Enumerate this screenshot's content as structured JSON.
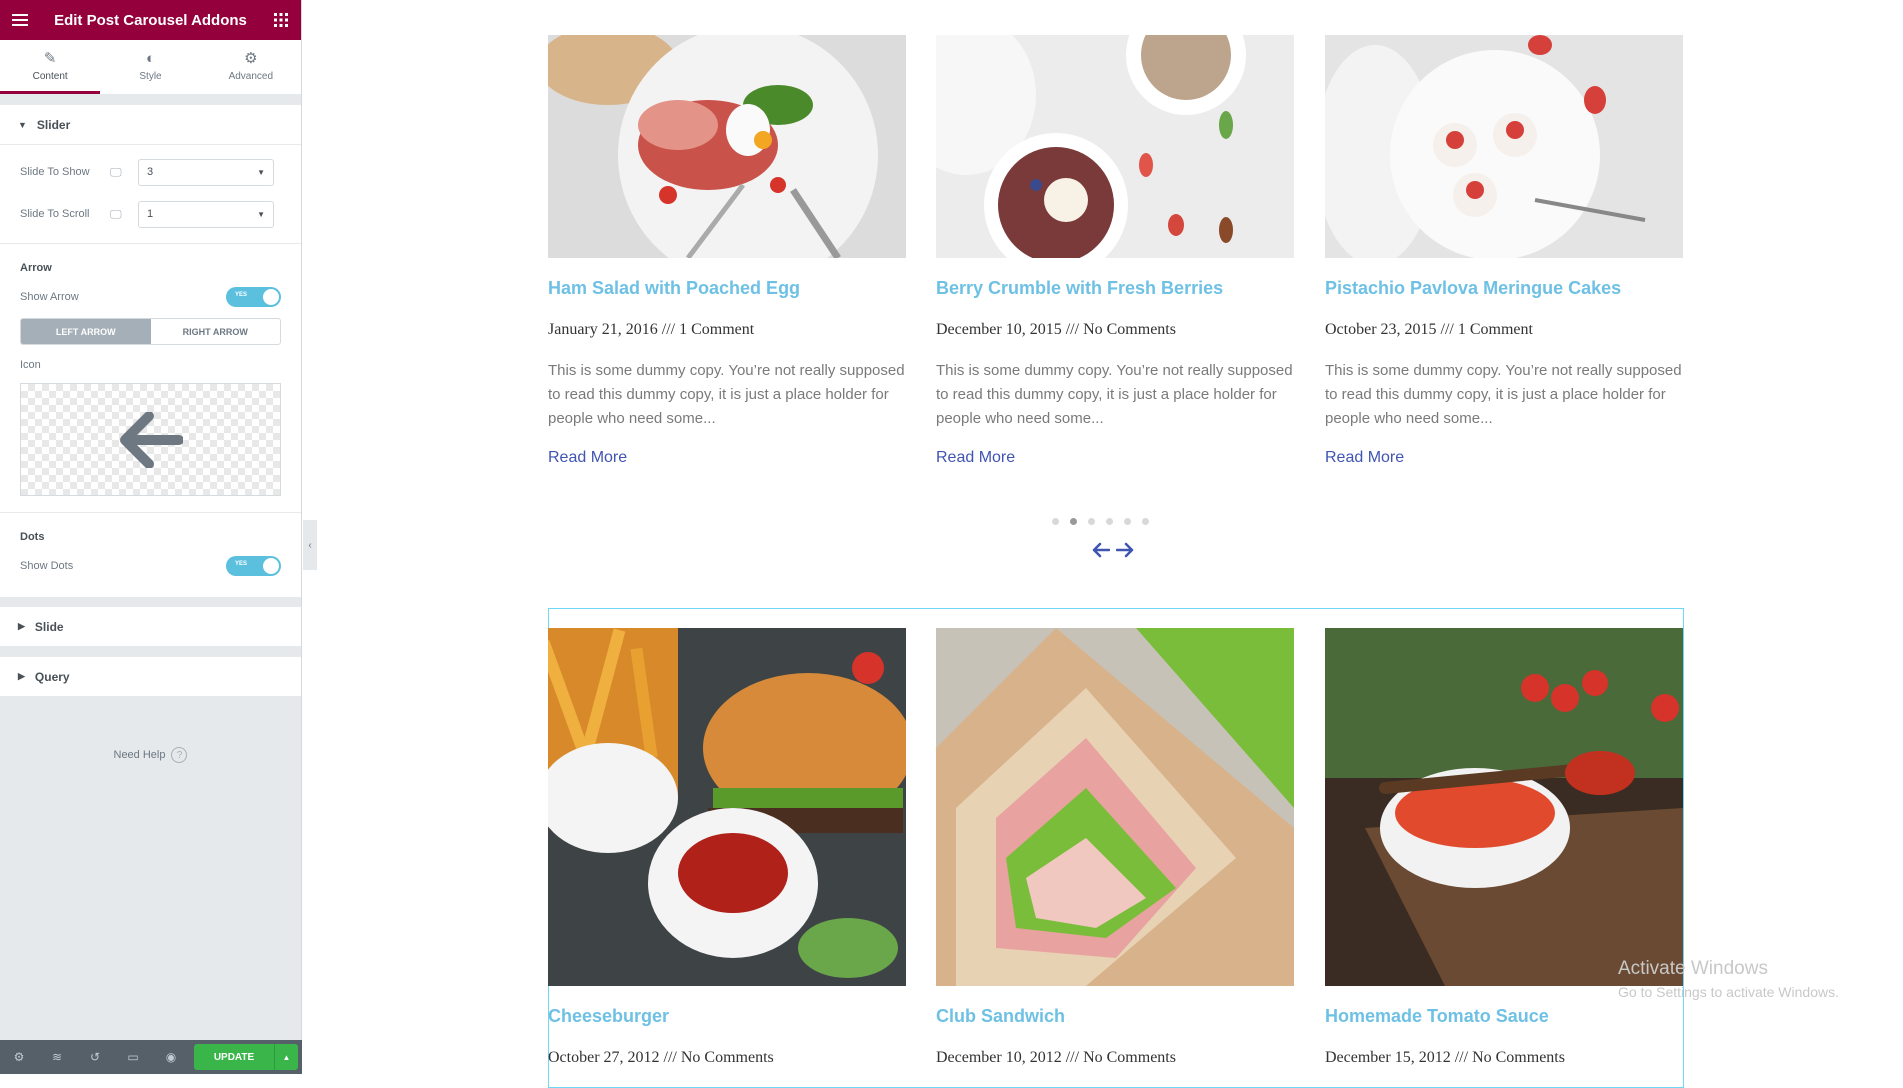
{
  "editor": {
    "title": "Edit Post Carousel Addons",
    "tabs": [
      {
        "label": "Content",
        "icon": "pencil-icon"
      },
      {
        "label": "Style",
        "icon": "half-circle-icon"
      },
      {
        "label": "Advanced",
        "icon": "gear-icon"
      }
    ],
    "slider_section": {
      "label": "Slider",
      "slide_to_show": {
        "label": "Slide To Show",
        "value": "3"
      },
      "slide_to_scroll": {
        "label": "Slide To Scroll",
        "value": "1"
      }
    },
    "arrow_section": {
      "label": "Arrow",
      "show_arrow_label": "Show Arrow",
      "show_arrow_toggle": "YES",
      "left_arrow": "LEFT ARROW",
      "right_arrow": "RIGHT ARROW",
      "icon_label": "Icon"
    },
    "dots_section": {
      "label": "Dots",
      "show_dots_label": "Show Dots",
      "show_dots_toggle": "YES"
    },
    "slide_section": {
      "label": "Slide"
    },
    "query_section": {
      "label": "Query"
    },
    "need_help": "Need Help",
    "update_label": "UPDATE"
  },
  "carousel_top": [
    {
      "title": "Ham Salad with Poached Egg",
      "meta": "January 21, 2016 /// 1 Comment",
      "excerpt": "This is some dummy copy. You’re not really supposed to read this dummy copy, it is just a place holder for people who need some...",
      "read_more": "Read More"
    },
    {
      "title": "Berry Crumble with Fresh Berries",
      "meta": "December 10, 2015 /// No Comments",
      "excerpt": "This is some dummy copy. You’re not really supposed to read this dummy copy, it is just a place holder for people who need some...",
      "read_more": "Read More"
    },
    {
      "title": "Pistachio Pavlova Meringue Cakes",
      "meta": "October 23, 2015 /// 1 Comment",
      "excerpt": "This is some dummy copy. You’re not really supposed to read this dummy copy, it is just a place holder for people who need some...",
      "read_more": "Read More"
    }
  ],
  "carousel_bottom": [
    {
      "title": "Cheeseburger",
      "meta": "October 27, 2012 /// No Comments"
    },
    {
      "title": "Club Sandwich",
      "meta": "December 10, 2012 /// No Comments"
    },
    {
      "title": "Homemade Tomato Sauce",
      "meta": "December 15, 2012 /// No Comments"
    }
  ],
  "dots": {
    "count": 6,
    "active": 1
  },
  "colors": {
    "brand": "#93003c",
    "title": "#6ec1e4",
    "link": "#4054b2",
    "toggle": "#5bc0de",
    "update": "#39b54a"
  },
  "watermark": {
    "line1": "Activate Windows",
    "line2": "Go to Settings to activate Windows."
  }
}
